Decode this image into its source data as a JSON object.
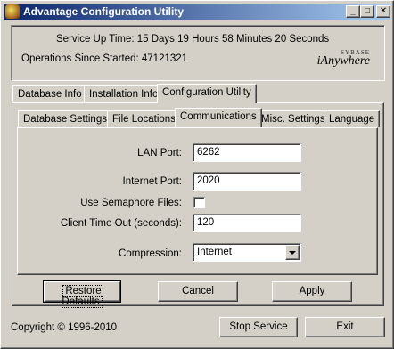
{
  "window": {
    "title": "Advantage Configuration Utility",
    "controls": {
      "minimize": "_",
      "maximize": "□",
      "close": "✕"
    }
  },
  "status": {
    "uptime": "Service Up Time: 15 Days 19 Hours 58 Minutes 20 Seconds",
    "operations": "Operations Since Started: 47121321"
  },
  "logo": {
    "top": "SYBASE",
    "main": "iAnywhere"
  },
  "main_tabs": [
    {
      "label": "Database Info",
      "active": false
    },
    {
      "label": "Installation Info",
      "active": false
    },
    {
      "label": "Configuration Utility",
      "active": true
    }
  ],
  "sub_tabs": [
    {
      "label": "Database Settings",
      "active": false
    },
    {
      "label": "File Locations",
      "active": false
    },
    {
      "label": "Communications",
      "active": true
    },
    {
      "label": "Misc. Settings",
      "active": false
    },
    {
      "label": "Language",
      "active": false
    }
  ],
  "form": {
    "lan_port": {
      "label": "LAN Port:",
      "value": "6262"
    },
    "internet_port": {
      "label": "Internet Port:",
      "value": "2020"
    },
    "semaphore": {
      "label": "Use Semaphore Files:",
      "checked": false
    },
    "client_timeout": {
      "label": "Client Time Out (seconds):",
      "value": "120"
    },
    "compression": {
      "label": "Compression:",
      "value": "Internet"
    }
  },
  "buttons": {
    "restore_defaults": "Restore Defaults",
    "cancel": "Cancel",
    "apply": "Apply",
    "stop_service": "Stop Service",
    "exit": "Exit"
  },
  "footer": {
    "copyright": "Copyright © 1996-2010"
  },
  "colors": {
    "face": "#d4d0c8",
    "title_start": "#0a246a",
    "title_end": "#a6caf0"
  }
}
